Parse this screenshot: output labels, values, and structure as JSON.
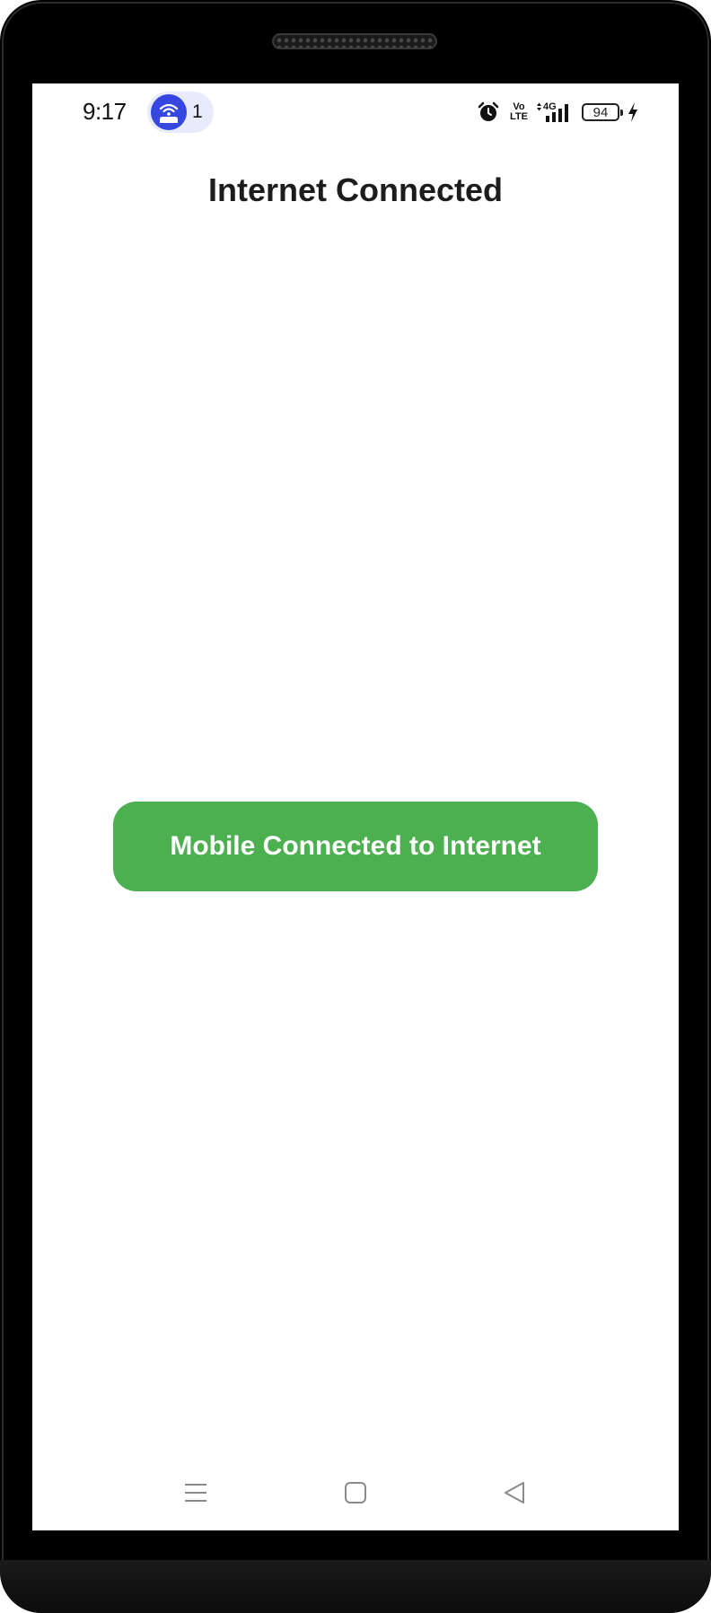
{
  "status_bar": {
    "time": "9:17",
    "notification_count": "1",
    "notification_icon": "wifi-router-icon",
    "volte_top": "Vo",
    "volte_bottom": "LTE",
    "network": "4G",
    "battery_level": "94",
    "charging": true
  },
  "main": {
    "title": "Internet Connected",
    "status_button_label": "Mobile Connected to Internet",
    "status_button_color": "#4caf50"
  },
  "nav_bar": {
    "items": [
      "menu-icon",
      "home-icon",
      "back-icon"
    ]
  }
}
